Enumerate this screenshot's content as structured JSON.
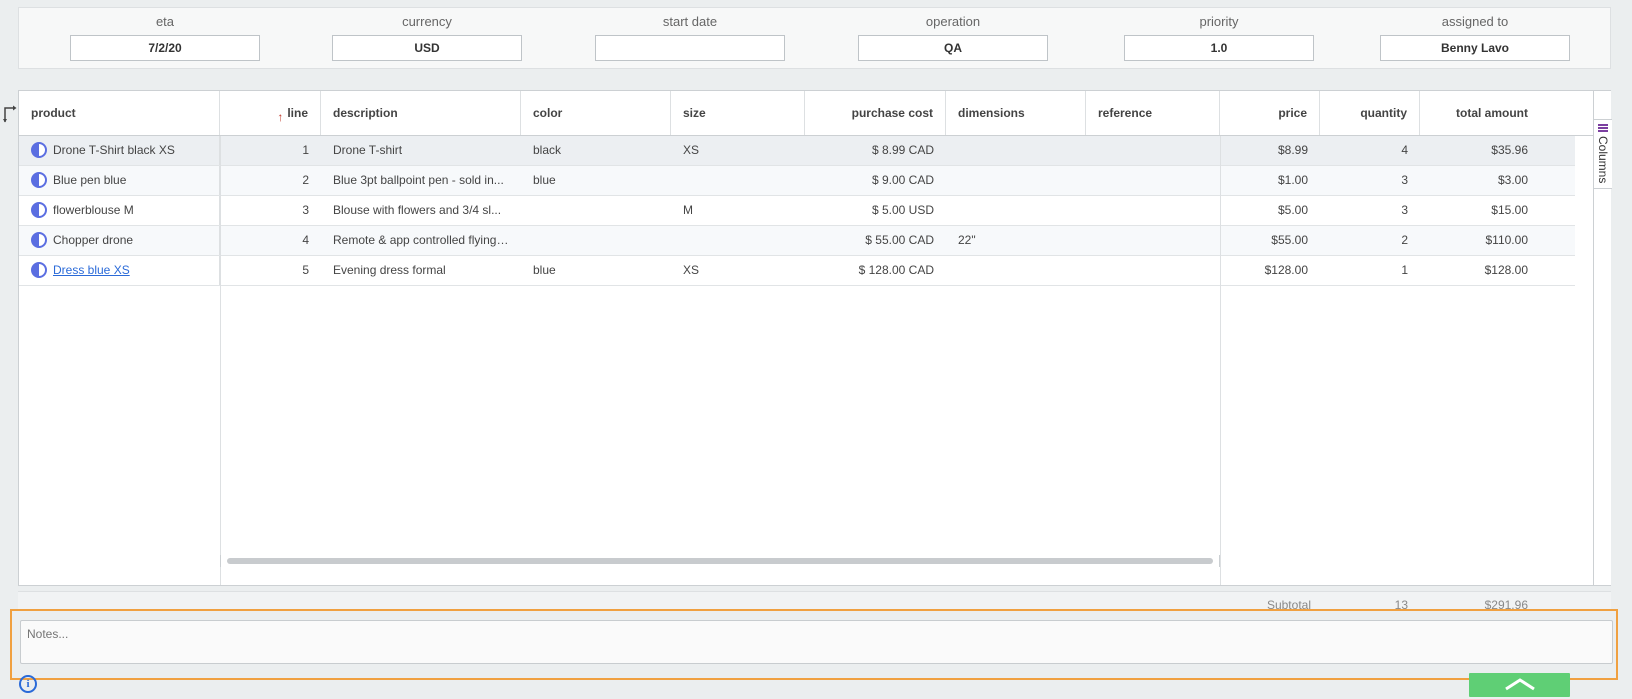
{
  "fields": [
    {
      "label": "eta",
      "value": "7/2/20"
    },
    {
      "label": "currency",
      "value": "USD"
    },
    {
      "label": "start date",
      "value": ""
    },
    {
      "label": "operation",
      "value": "QA"
    },
    {
      "label": "priority",
      "value": "1.0"
    },
    {
      "label": "assigned to",
      "value": "Benny Lavo"
    }
  ],
  "grid": {
    "headers": {
      "product": "product",
      "line": "line",
      "line_sort": "↑",
      "description": "description",
      "color": "color",
      "size": "size",
      "purchase_cost": "purchase cost",
      "dimensions": "dimensions",
      "reference": "reference",
      "price": "price",
      "quantity": "quantity",
      "total_amount": "total amount"
    },
    "rows": [
      {
        "product": "Drone T-Shirt black XS",
        "line": "1",
        "description": "Drone T-shirt",
        "color": "black",
        "size": "XS",
        "purchase_cost": "$ 8.99 CAD",
        "dimensions": "",
        "reference": "",
        "price": "$8.99",
        "quantity": "4",
        "total_amount": "$35.96"
      },
      {
        "product": "Blue pen blue",
        "line": "2",
        "description": "Blue 3pt ballpoint pen - sold in...",
        "color": "blue",
        "size": "",
        "purchase_cost": "$ 9.00 CAD",
        "dimensions": "",
        "reference": "",
        "price": "$1.00",
        "quantity": "3",
        "total_amount": "$3.00"
      },
      {
        "product": "flowerblouse M",
        "line": "3",
        "description": "Blouse with flowers and 3/4 sl...",
        "color": "",
        "size": "M",
        "purchase_cost": "$ 5.00 USD",
        "dimensions": "",
        "reference": "",
        "price": "$5.00",
        "quantity": "3",
        "total_amount": "$15.00"
      },
      {
        "product": "Chopper drone",
        "line": "4",
        "description": "Remote & app controlled flying ...",
        "color": "",
        "size": "",
        "purchase_cost": "$ 55.00 CAD",
        "dimensions": "22\"",
        "reference": "",
        "price": "$55.00",
        "quantity": "2",
        "total_amount": "$110.00"
      },
      {
        "product": "Dress blue XS",
        "line": "5",
        "description": "Evening dress formal",
        "color": "blue",
        "size": "XS",
        "purchase_cost": "$ 128.00 CAD",
        "dimensions": "",
        "reference": "",
        "price": "$128.00",
        "quantity": "1",
        "total_amount": "$128.00"
      }
    ],
    "columns_panel_label": "Columns",
    "footer": {
      "label": "Subtotal",
      "quantity": "13",
      "total": "$291.96"
    }
  },
  "notes": {
    "placeholder": "Notes..."
  },
  "icons": {
    "info": "info-icon",
    "collapse": "chevron-up-icon",
    "split": "split-arrow-icon",
    "product": "half-circle-icon",
    "columns": "columns-list-icon"
  },
  "colors": {
    "accent_highlight": "#f0a040",
    "collapse_button": "#5fcf75",
    "link": "#2a6ad8"
  }
}
